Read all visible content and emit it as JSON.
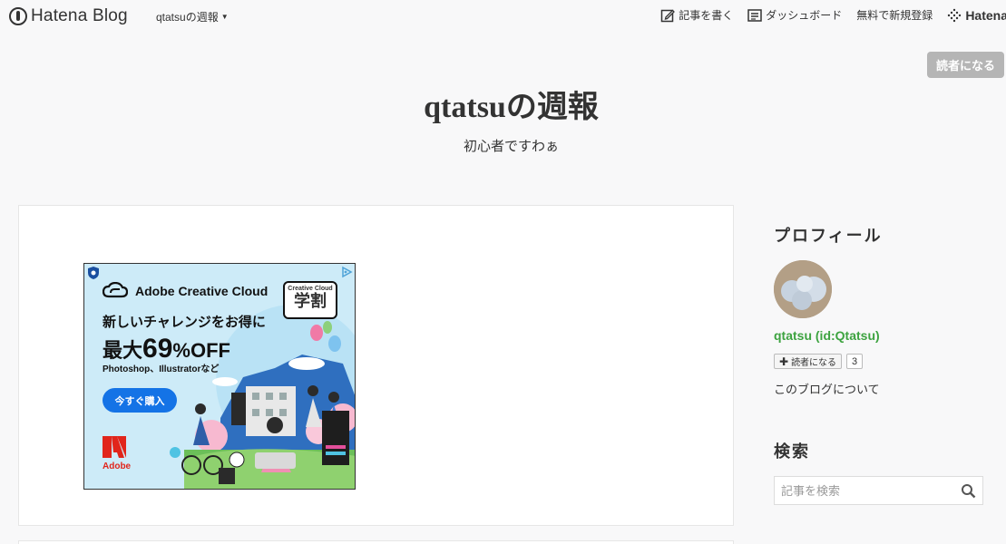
{
  "topbar": {
    "brand": "Hatena Blog",
    "blog_switch": "qtatsuの週報",
    "write": "記事を書く",
    "dashboard": "ダッシュボード",
    "register": "無料で新規登録",
    "hatena": "Hatena"
  },
  "subscribe_top": "読者になる",
  "header": {
    "title": "qtatsuの週報",
    "description": "初心者ですわぁ"
  },
  "ad": {
    "brand": "Adobe Creative Cloud",
    "badge_small": "Creative Cloud",
    "badge_big": "学割",
    "headline": "新しいチャレンジをお得に",
    "discount_prefix": "最大",
    "discount_value": "69",
    "discount_suffix": "%OFF",
    "products": "Photoshop、Illustratorなど",
    "cta": "今すぐ購入",
    "adobe": "Adobe"
  },
  "sidebar": {
    "profile_heading": "プロフィール",
    "profile_name": "qtatsu (id:Qtatsu)",
    "subscribe_label": "読者になる",
    "subscriber_count": "3",
    "about": "このブログについて",
    "search_heading": "検索",
    "search_placeholder": "記事を検索"
  },
  "colors": {
    "profile_link": "#3da340",
    "subscribe_top_bg": "#b5b5b5",
    "ad_cta": "#1473e6",
    "adobe_red": "#e1251b"
  }
}
